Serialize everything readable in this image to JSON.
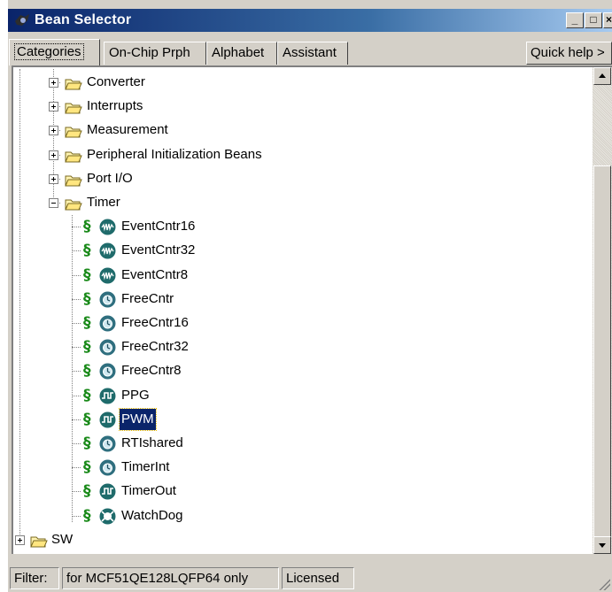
{
  "window": {
    "title": "Bean Selector"
  },
  "tabs": [
    {
      "label": "Categories",
      "active": true
    },
    {
      "label": "On-Chip Prph",
      "active": false
    },
    {
      "label": "Alphabet",
      "active": false
    },
    {
      "label": "Assistant",
      "active": false
    }
  ],
  "quick_help_label": "Quick help >",
  "tree": {
    "categories": [
      {
        "label": "Converter",
        "expanded": false
      },
      {
        "label": "Interrupts",
        "expanded": false
      },
      {
        "label": "Measurement",
        "expanded": false
      },
      {
        "label": "Peripheral Initialization Beans",
        "expanded": false
      },
      {
        "label": "Port I/O",
        "expanded": false
      },
      {
        "label": "Timer",
        "expanded": true
      }
    ],
    "timer_beans": [
      {
        "label": "EventCntr16",
        "icon": "event-counter-icon",
        "selected": false
      },
      {
        "label": "EventCntr32",
        "icon": "event-counter-icon",
        "selected": false
      },
      {
        "label": "EventCntr8",
        "icon": "event-counter-icon",
        "selected": false
      },
      {
        "label": "FreeCntr",
        "icon": "free-counter-icon",
        "selected": false
      },
      {
        "label": "FreeCntr16",
        "icon": "free-counter-icon",
        "selected": false
      },
      {
        "label": "FreeCntr32",
        "icon": "free-counter-icon",
        "selected": false
      },
      {
        "label": "FreeCntr8",
        "icon": "free-counter-icon",
        "selected": false
      },
      {
        "label": "PPG",
        "icon": "pulse-generator-icon",
        "selected": false
      },
      {
        "label": "PWM",
        "icon": "pulse-generator-icon",
        "selected": true
      },
      {
        "label": "RTIshared",
        "icon": "free-counter-icon",
        "selected": false
      },
      {
        "label": "TimerInt",
        "icon": "free-counter-icon",
        "selected": false
      },
      {
        "label": "TimerOut",
        "icon": "pulse-generator-icon",
        "selected": false
      },
      {
        "label": "WatchDog",
        "icon": "watchdog-icon",
        "selected": false
      }
    ],
    "root_sibling": {
      "label": "SW",
      "expanded": false
    }
  },
  "status": {
    "filter_label": "Filter:",
    "filter_value": "for MCF51QE128LQFP64 only",
    "license": "Licensed"
  },
  "colors": {
    "selection": "#0a246a",
    "title_gradient_start": "#0a246a",
    "bean_marker": "#1a8a1a",
    "bean_icon": "#1f6b6b"
  }
}
